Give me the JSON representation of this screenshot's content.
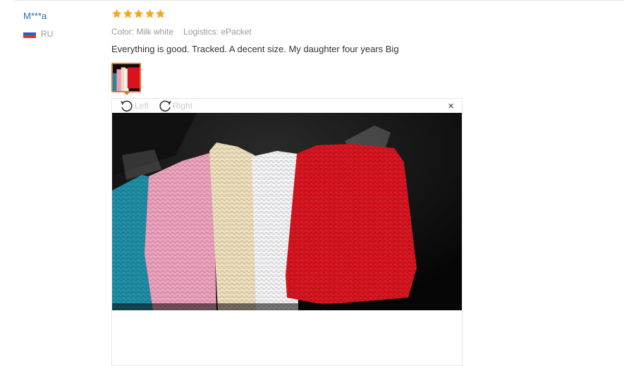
{
  "reviewer": {
    "name": "M***a",
    "country_code": "RU",
    "flag": [
      "#ffffff",
      "#2f5cc8",
      "#e0352b"
    ]
  },
  "rating": {
    "stars": 5,
    "max": 5,
    "color": "#f5a623"
  },
  "attributes": {
    "color": "Color: Milk white",
    "logistics": "Logistics: ePacket"
  },
  "review_text": "Everything is good. Tracked. A decent size. My daughter four years Big",
  "viewer": {
    "rotate_left_label": "Left",
    "rotate_right_label": "Right",
    "close_symbol": "×"
  },
  "accent_color": "#e0762a"
}
